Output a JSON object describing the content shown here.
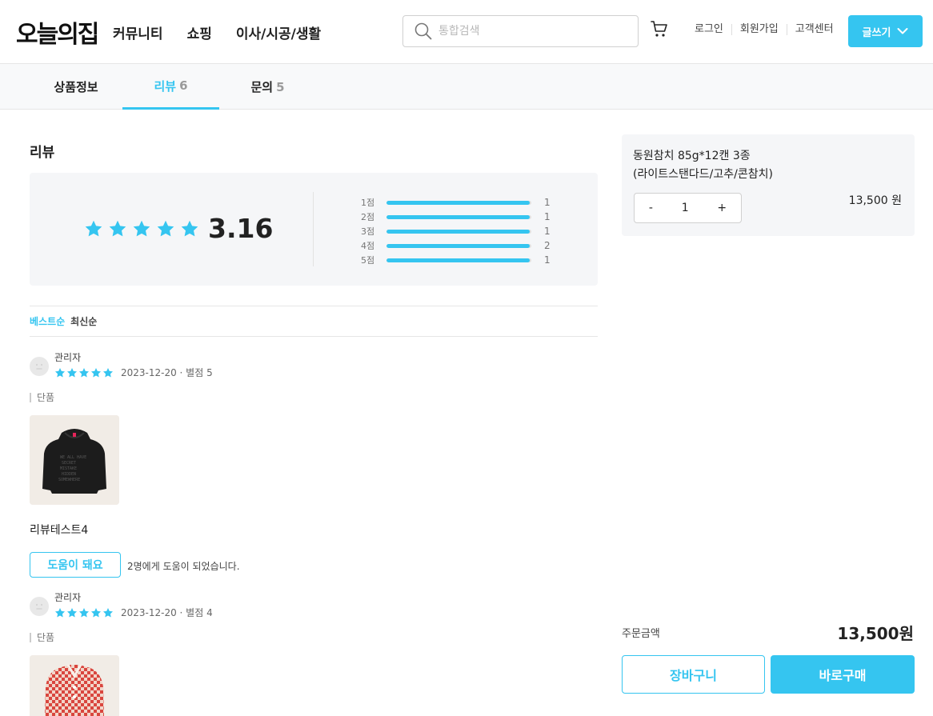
{
  "header": {
    "logo": "오늘의집",
    "nav": [
      "커뮤니티",
      "쇼핑",
      "이사/시공/생활"
    ],
    "search_placeholder": "통합검색",
    "util": [
      "로그인",
      "회원가입",
      "고객센터"
    ],
    "write_label": "글쓰기"
  },
  "tabs": [
    {
      "label": "상품정보",
      "count": ""
    },
    {
      "label": "리뷰",
      "count": "6"
    },
    {
      "label": "문의",
      "count": "5"
    }
  ],
  "review_section": {
    "title": "리뷰",
    "average": "3.16",
    "distribution": [
      {
        "label": "1점",
        "count": "1",
        "fill": 0.99
      },
      {
        "label": "2점",
        "count": "1",
        "fill": 0.99
      },
      {
        "label": "3점",
        "count": "1",
        "fill": 0.99
      },
      {
        "label": "4점",
        "count": "2",
        "fill": 0.99
      },
      {
        "label": "5점",
        "count": "1",
        "fill": 0.99
      }
    ],
    "sort": [
      "베스트순",
      "최신순"
    ]
  },
  "reviews": [
    {
      "author": "관리자",
      "date_rating": "2023-12-20 · 별점 5",
      "option": "단품",
      "text": "리뷰테스트4",
      "help_label": "도움이 돼요",
      "help_text": "2명에게 도움이 되었습니다."
    },
    {
      "author": "관리자",
      "date_rating": "2023-12-20 · 별점 4",
      "option": "단품",
      "text": "",
      "help_label": "",
      "help_text": ""
    }
  ],
  "order": {
    "product_name_line1": "동원참치 85g*12캔 3종",
    "product_name_line2": "(라이트스탠다드/고추/콘참치)",
    "minus": "-",
    "quantity": "1",
    "plus": "+",
    "option_price": "13,500 원",
    "total_label": "주문금액",
    "total_value": "13,500원",
    "cart_label": "장바구니",
    "buy_label": "바로구매"
  },
  "colors": {
    "accent": "#35c5f0"
  }
}
